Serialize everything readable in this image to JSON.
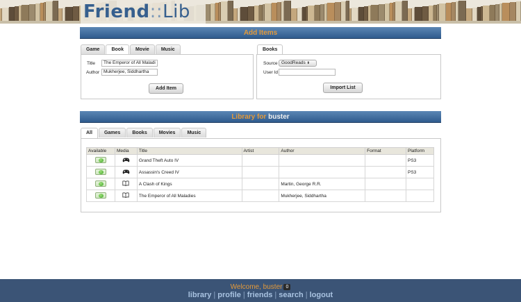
{
  "app": {
    "logo_part1": "Friend",
    "logo_sep": "::",
    "logo_part2": "Lib"
  },
  "add_items": {
    "title": "Add Items",
    "tabs": [
      "Game",
      "Book",
      "Movie",
      "Music"
    ],
    "active_tab": "Book",
    "title_label": "Title",
    "title_value": "The Emperor of All Maladi",
    "author_label": "Author",
    "author_value": "Mukherjee, Siddhartha",
    "add_button": "Add Item",
    "import_tab": "Books",
    "source_label": "Source",
    "source_value": "GoodReads",
    "userid_label": "User Id",
    "userid_value": "",
    "import_button": "Import List"
  },
  "library": {
    "title_prefix": "Library for",
    "username": "buster",
    "tabs": [
      "All",
      "Games",
      "Books",
      "Movies",
      "Music"
    ],
    "active_tab": "All",
    "columns": [
      "Available",
      "Media",
      "Title",
      "Artist",
      "Author",
      "Format",
      "Platform"
    ],
    "rows": [
      {
        "media": "gamepad-icon",
        "title": "Grand Theft Auto IV",
        "artist": "",
        "author": "",
        "format": "",
        "platform": "PS3"
      },
      {
        "media": "gamepad-icon",
        "title": "Assassin's Creed IV",
        "artist": "",
        "author": "",
        "format": "",
        "platform": "PS3"
      },
      {
        "media": "book-icon",
        "title": "A Clash of Kings",
        "artist": "",
        "author": "Martin, George R.R.",
        "format": "",
        "platform": ""
      },
      {
        "media": "book-icon",
        "title": "The Emperor of All Maladies",
        "artist": "",
        "author": "Mukherjee, Siddhartha",
        "format": "",
        "platform": ""
      }
    ]
  },
  "footer": {
    "welcome": "Welcome, buster",
    "badge": "0",
    "links": [
      "library",
      "profile",
      "friends",
      "search",
      "logout"
    ]
  },
  "colors": {
    "accent": "#e39a3b",
    "bar_blue": "#2f5b8d",
    "footer_bg": "#3b5476",
    "link": "#a9c3e1"
  }
}
